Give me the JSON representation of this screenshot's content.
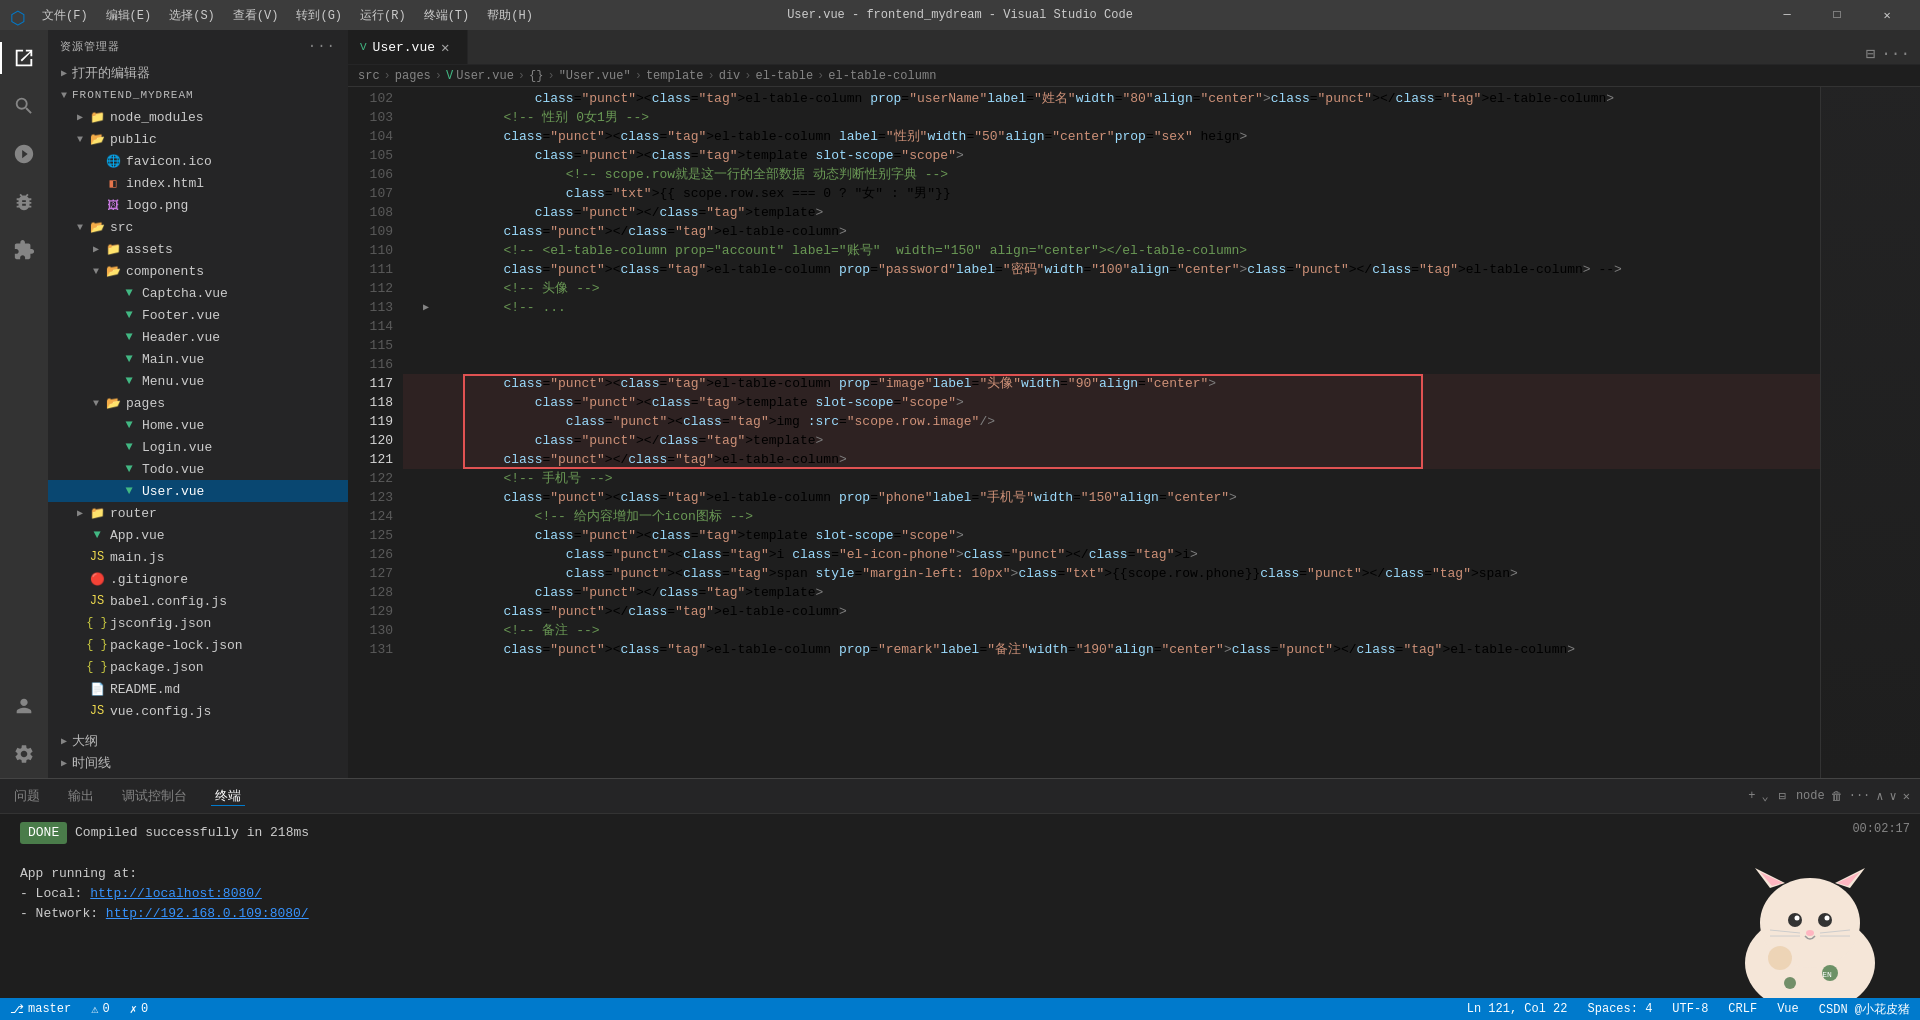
{
  "titleBar": {
    "icon": "⬡",
    "menu": [
      "文件(F)",
      "编辑(E)",
      "选择(S)",
      "查看(V)",
      "转到(G)",
      "运行(R)",
      "终端(T)",
      "帮助(H)"
    ],
    "title": "User.vue - frontend_mydream - Visual Studio Code",
    "buttons": [
      "─",
      "□",
      "✕"
    ]
  },
  "activityBar": {
    "icons": [
      "explorer",
      "search",
      "git",
      "debug",
      "extensions",
      "account",
      "settings"
    ]
  },
  "sidebar": {
    "header": "资源管理器",
    "openEditors": "打开的编辑器",
    "tree": {
      "root": "FRONTEND_MYDREAM",
      "items": [
        {
          "id": "node_modules",
          "label": "node_modules",
          "type": "folder",
          "depth": 1,
          "collapsed": true
        },
        {
          "id": "public",
          "label": "public",
          "type": "folder",
          "depth": 1,
          "collapsed": false
        },
        {
          "id": "favicon.ico",
          "label": "favicon.ico",
          "type": "file-ico",
          "depth": 2
        },
        {
          "id": "index.html",
          "label": "index.html",
          "type": "file-html",
          "depth": 2
        },
        {
          "id": "logo.png",
          "label": "logo.png",
          "type": "file-img",
          "depth": 2
        },
        {
          "id": "src",
          "label": "src",
          "type": "folder",
          "depth": 1,
          "collapsed": false
        },
        {
          "id": "assets",
          "label": "assets",
          "type": "folder",
          "depth": 2,
          "collapsed": true
        },
        {
          "id": "components",
          "label": "components",
          "type": "folder",
          "depth": 2,
          "collapsed": false
        },
        {
          "id": "Captcha.vue",
          "label": "Captcha.vue",
          "type": "file-vue",
          "depth": 3
        },
        {
          "id": "Footer.vue",
          "label": "Footer.vue",
          "type": "file-vue",
          "depth": 3
        },
        {
          "id": "Header.vue",
          "label": "Header.vue",
          "type": "file-vue",
          "depth": 3
        },
        {
          "id": "Main.vue",
          "label": "Main.vue",
          "type": "file-vue",
          "depth": 3
        },
        {
          "id": "Menu.vue",
          "label": "Menu.vue",
          "type": "file-vue",
          "depth": 3
        },
        {
          "id": "pages",
          "label": "pages",
          "type": "folder",
          "depth": 2,
          "collapsed": false
        },
        {
          "id": "Home.vue",
          "label": "Home.vue",
          "type": "file-vue",
          "depth": 3
        },
        {
          "id": "Login.vue",
          "label": "Login.vue",
          "type": "file-vue",
          "depth": 3
        },
        {
          "id": "Todo.vue",
          "label": "Todo.vue",
          "type": "file-vue",
          "depth": 3
        },
        {
          "id": "User.vue",
          "label": "User.vue",
          "type": "file-vue",
          "depth": 3,
          "selected": true
        },
        {
          "id": "router",
          "label": "router",
          "type": "folder",
          "depth": 1,
          "collapsed": true
        },
        {
          "id": "App.vue",
          "label": "App.vue",
          "type": "file-vue",
          "depth": 1
        },
        {
          "id": "main.js",
          "label": "main.js",
          "type": "file-js",
          "depth": 1
        },
        {
          "id": ".gitignore",
          "label": ".gitignore",
          "type": "file-git",
          "depth": 1
        },
        {
          "id": "babel.config.js",
          "label": "babel.config.js",
          "type": "file-js",
          "depth": 1
        },
        {
          "id": "jsconfig.json",
          "label": "jsconfig.json",
          "type": "file-json",
          "depth": 1
        },
        {
          "id": "package-lock.json",
          "label": "package-lock.json",
          "type": "file-json",
          "depth": 1
        },
        {
          "id": "package.json",
          "label": "package.json",
          "type": "file-json",
          "depth": 1
        },
        {
          "id": "README.md",
          "label": "README.md",
          "type": "file-md",
          "depth": 1
        },
        {
          "id": "vue.config.js",
          "label": "vue.config.js",
          "type": "file-js",
          "depth": 1
        }
      ],
      "bottom": [
        {
          "id": "outline",
          "label": "大纲",
          "collapsed": true
        },
        {
          "id": "timeline",
          "label": "时间线",
          "collapsed": true
        }
      ]
    }
  },
  "editor": {
    "tab": {
      "icon": "V",
      "label": "User.vue",
      "modified": false
    },
    "breadcrumb": [
      "src",
      "pages",
      "User.vue",
      "{}",
      "\"User.vue\"",
      "template",
      "div",
      "el-table",
      "el-table-column"
    ],
    "startLine": 102,
    "lines": [
      {
        "num": 102,
        "indent": 12,
        "content": "<el-table-column prop=\"userName\" label=\"姓名\"  width=\"80\" align=\"center\" ></el-table-column>"
      },
      {
        "num": 103,
        "indent": 8,
        "content": "<!-- 性别 0女1男 -->"
      },
      {
        "num": 104,
        "indent": 8,
        "content": "<el-table-column label=\"性别\" width=\"50\" align=\"center\" prop=\"sex\" heign>"
      },
      {
        "num": 105,
        "indent": 12,
        "content": "<template slot-scope=\"scope\">"
      },
      {
        "num": 106,
        "indent": 16,
        "content": "<!-- scope.row就是这一行的全部数据 动态判断性别字典 -->"
      },
      {
        "num": 107,
        "indent": 16,
        "content": "{{ scope.row.sex === 0 ? \"女\" : \"男\"}}"
      },
      {
        "num": 108,
        "indent": 12,
        "content": "</template>"
      },
      {
        "num": 109,
        "indent": 8,
        "content": "</el-table-column>"
      },
      {
        "num": 110,
        "indent": 8,
        "content": "<!-- <el-table-column prop=\"account\" label=\"账号\"  width=\"150\" align=\"center\"></el-table-column>"
      },
      {
        "num": 111,
        "indent": 8,
        "content": "<el-table-column prop=\"password\" label=\"密码\" width=\"100\" align=\"center\"></el-table-column> -->"
      },
      {
        "num": 112,
        "indent": 8,
        "content": "<!-- 头像 -->"
      },
      {
        "num": 113,
        "indent": 8,
        "content": "<!-- ..."
      },
      {
        "num": 114,
        "indent": 0,
        "content": ""
      },
      {
        "num": 115,
        "indent": 0,
        "content": ""
      },
      {
        "num": 116,
        "indent": 0,
        "content": ""
      },
      {
        "num": 117,
        "indent": 8,
        "content": "<el-table-column prop=\"image\" label=\"头像\" width=\"90\"  align=\"center\">",
        "highlighted": true
      },
      {
        "num": 118,
        "indent": 12,
        "content": "<template slot-scope=\"scope\">",
        "highlighted": true
      },
      {
        "num": 119,
        "indent": 16,
        "content": "<img :src=\"scope.row.image\" />",
        "highlighted": true
      },
      {
        "num": 120,
        "indent": 12,
        "content": "</template>",
        "highlighted": true
      },
      {
        "num": 121,
        "indent": 8,
        "content": "</el-table-column>",
        "highlighted": true
      },
      {
        "num": 122,
        "indent": 8,
        "content": "<!-- 手机号 -->"
      },
      {
        "num": 123,
        "indent": 8,
        "content": "<el-table-column prop=\"phone\" label=\"手机号\" width=\"150\" align=\"center\">"
      },
      {
        "num": 124,
        "indent": 12,
        "content": "<!-- 给内容增加一个icon图标 -->"
      },
      {
        "num": 125,
        "indent": 12,
        "content": "<template slot-scope=\"scope\">"
      },
      {
        "num": 126,
        "indent": 16,
        "content": "<i class=\"el-icon-phone\"></i>"
      },
      {
        "num": 127,
        "indent": 16,
        "content": "<span style=\"margin-left: 10px\">{{scope.row.phone}}</span>"
      },
      {
        "num": 128,
        "indent": 12,
        "content": "</template>"
      },
      {
        "num": 129,
        "indent": 8,
        "content": "</el-table-column>"
      },
      {
        "num": 130,
        "indent": 8,
        "content": "<!-- 备注 -->"
      },
      {
        "num": 131,
        "indent": 8,
        "content": "<el-table-column prop=\"remark\" label=\"备注\" width=\"190\" align=\"center\"></el-table-column>"
      }
    ]
  },
  "panel": {
    "tabs": [
      "问题",
      "输出",
      "调试控制台",
      "终端"
    ],
    "activeTab": "终端",
    "terminalContent": [
      {
        "type": "status",
        "done": "DONE",
        "text": " Compiled successfully in 218ms"
      },
      {
        "type": "blank"
      },
      {
        "type": "text",
        "text": "App running at:"
      },
      {
        "type": "link",
        "label": "  - Local:   ",
        "link": "http://localhost:8080/"
      },
      {
        "type": "link",
        "label": "  - Network: ",
        "link": "http://192.168.0.109:8080/"
      }
    ],
    "time": "00:02:17",
    "headerRight": [
      "+  ✕  node  ⊟  🗑  ···  ∧  ∨  ✕"
    ]
  },
  "statusBar": {
    "left": [
      {
        "icon": "⎇",
        "text": "master"
      },
      {
        "icon": "⚠",
        "text": "0"
      },
      {
        "icon": "✗",
        "text": "0"
      }
    ],
    "right": [
      {
        "text": "Ln 121, Col 22"
      },
      {
        "text": "Spaces: 4"
      },
      {
        "text": "UTF-8"
      },
      {
        "text": "CRLF"
      },
      {
        "text": "Vue"
      },
      {
        "text": "CSDN @小花皮猪"
      }
    ]
  }
}
